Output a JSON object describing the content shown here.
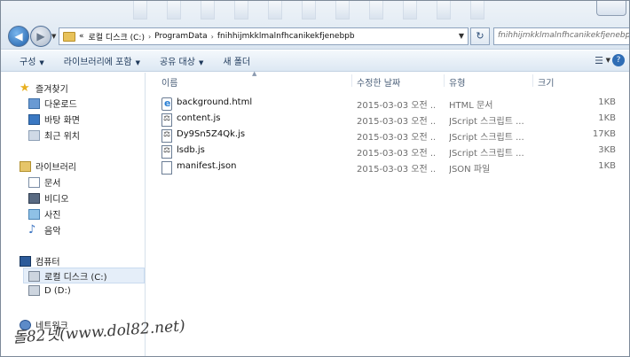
{
  "address": {
    "prefix": "«",
    "crumbs": [
      "로컬 디스크 (C:)",
      "ProgramData",
      "fnihhijmkklmalnfhcanikekfjenebpb"
    ],
    "separator": "›"
  },
  "search": {
    "text": "fnihhijmkklmalnfhcanikekfjenebpb"
  },
  "toolbar": {
    "organize": "구성",
    "include_in_library": "라이브러리에 포함",
    "share_with": "공유 대상",
    "new_folder": "새 폴더"
  },
  "nav": {
    "favorites": "즐겨찾기",
    "downloads": "다운로드",
    "desktop": "바탕 화면",
    "recent": "최근 위치",
    "libraries": "라이브러리",
    "documents": "문서",
    "videos": "비디오",
    "pictures": "사진",
    "music": "음악",
    "computer": "컴퓨터",
    "local_disk": "로컬 디스크 (C:)",
    "disk_d": "D (D:)",
    "network": "네트워크"
  },
  "columns": {
    "name": "이름",
    "modified": "수정한 날짜",
    "type": "유형",
    "size": "크기"
  },
  "files": [
    {
      "name": "background.html",
      "modified": "2015-03-03 오전 ...",
      "type": "HTML 문서",
      "size": "1KB",
      "icon": "html-icon"
    },
    {
      "name": "content.js",
      "modified": "2015-03-03 오전 ...",
      "type": "JScript 스크립트 ...",
      "size": "1KB",
      "icon": "jscript-icon"
    },
    {
      "name": "Dy9Sn5Z4Qk.js",
      "modified": "2015-03-03 오전 ...",
      "type": "JScript 스크립트 ...",
      "size": "17KB",
      "icon": "jscript-icon"
    },
    {
      "name": "lsdb.js",
      "modified": "2015-03-03 오전 ...",
      "type": "JScript 스크립트 ...",
      "size": "3KB",
      "icon": "jscript-icon"
    },
    {
      "name": "manifest.json",
      "modified": "2015-03-03 오전 ...",
      "type": "JSON 파일",
      "size": "1KB",
      "icon": "json-icon"
    }
  ],
  "watermark": "돌82넷(www.dol82.net)"
}
